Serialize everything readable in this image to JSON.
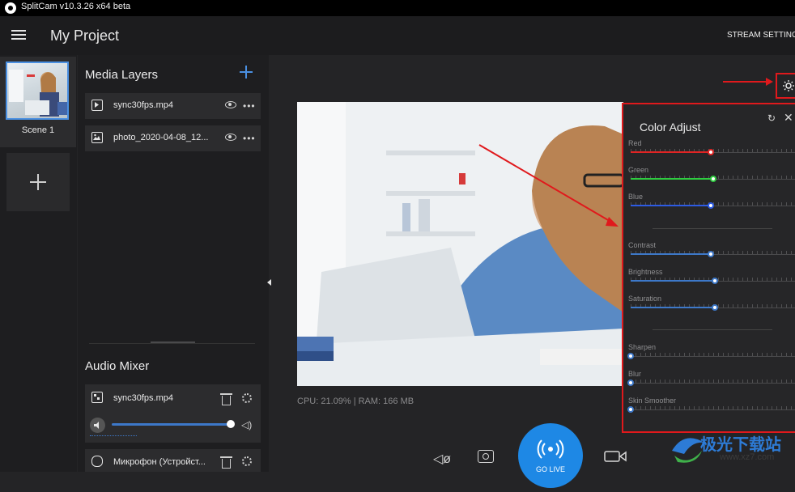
{
  "titlebar": {
    "title": "SplitCam v10.3.26 x64 beta"
  },
  "header": {
    "project_title": "My Project",
    "stream_settings": "STREAM SETTINGS"
  },
  "scenes": {
    "items": [
      {
        "label": "Scene 1"
      }
    ]
  },
  "layers": {
    "title": "Media Layers",
    "items": [
      {
        "label": "sync30fps.mp4",
        "icon": "video-file-icon"
      },
      {
        "label": "photo_2020-04-08_12...",
        "icon": "image-file-icon"
      }
    ]
  },
  "audio_mixer": {
    "title": "Audio Mixer",
    "items": [
      {
        "label": "sync30fps.mp4",
        "volume": 0.98
      },
      {
        "label": "Микрофон (Устройст..."
      }
    ]
  },
  "canvas": {
    "stats": "CPU: 21.09% | RAM: 166 MB"
  },
  "color_adjust": {
    "title": "Color Adjust",
    "sliders": [
      {
        "label": "Red",
        "value": 0.49,
        "color": "#e02424"
      },
      {
        "label": "Green",
        "value": 0.5,
        "color": "#2ecc40"
      },
      {
        "label": "Blue",
        "value": 0.49,
        "color": "#2d5be3"
      },
      {
        "label": "Contrast",
        "value": 0.49,
        "color": "#3d78c9"
      },
      {
        "label": "Brightness",
        "value": 0.51,
        "color": "#3d78c9"
      },
      {
        "label": "Saturation",
        "value": 0.51,
        "color": "#3d78c9"
      },
      {
        "label": "Sharpen",
        "value": 0.0,
        "color": "#3d78c9"
      },
      {
        "label": "Blur",
        "value": 0.0,
        "color": "#3d78c9"
      },
      {
        "label": "Skin Smoother",
        "value": 0.0,
        "color": "#3d78c9"
      }
    ]
  },
  "toolbar": {
    "go_live": "GO LIVE"
  },
  "watermark": {
    "text": "极光下载站",
    "url": "www.xz7.com"
  },
  "colors": {
    "accent": "#1e88e5",
    "annotation": "#e0191c"
  }
}
